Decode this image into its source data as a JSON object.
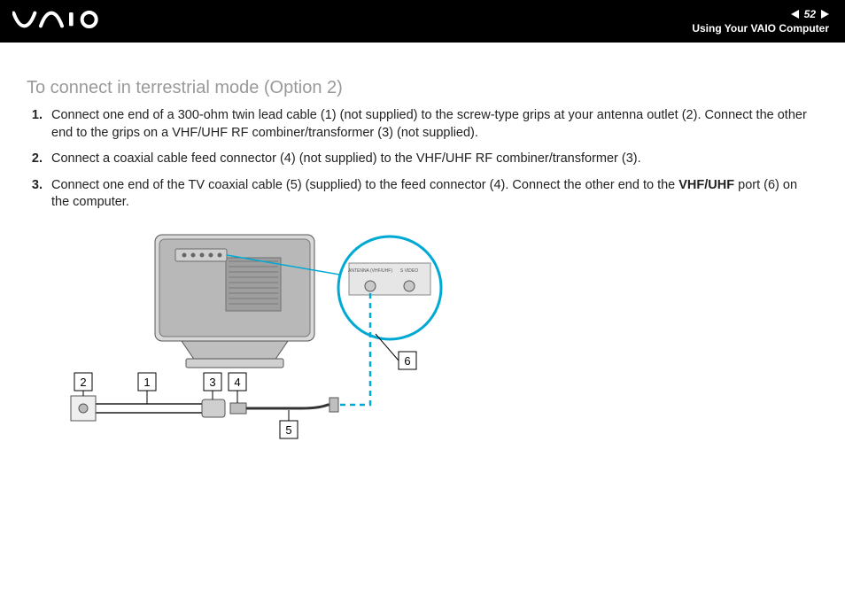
{
  "header": {
    "page_number": "52",
    "section": "Using Your VAIO Computer"
  },
  "heading": "To connect in terrestrial mode (Option 2)",
  "steps": [
    {
      "n": "1",
      "text": "Connect one end of a 300-ohm twin lead cable (1) (not supplied) to the screw-type grips at your antenna outlet (2). Connect the other end to the grips on a VHF/UHF RF combiner/transformer (3) (not supplied)."
    },
    {
      "n": "2",
      "text": "Connect a coaxial cable feed connector (4) (not supplied) to the VHF/UHF RF combiner/transformer (3)."
    },
    {
      "n": "3",
      "pre": "Connect one end of the TV coaxial cable (5) (supplied) to the feed connector (4). Connect the other end to the ",
      "bold": "VHF/UHF",
      "post": " port (6) on the computer."
    }
  ],
  "diagram": {
    "callouts": [
      "1",
      "2",
      "3",
      "4",
      "5",
      "6"
    ],
    "port_labels": [
      "ANTENNA (VHF/UHF)",
      "S VIDEO"
    ]
  }
}
